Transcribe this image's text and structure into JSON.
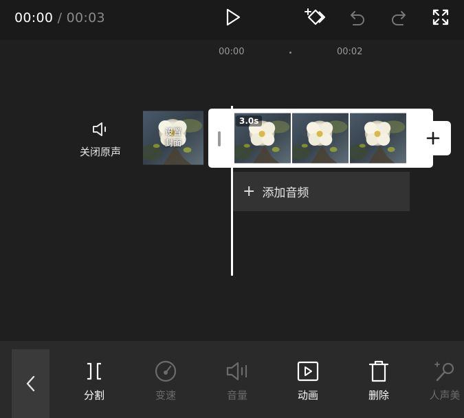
{
  "top_bar": {
    "current_time": "00:00",
    "separator": " / ",
    "total_time": "00:03",
    "icons": [
      "play-icon",
      "keyframe-icon",
      "undo-icon",
      "redo-icon",
      "fullscreen-icon"
    ]
  },
  "timeline": {
    "ruler": [
      "00:00",
      "00:02"
    ],
    "mute_label": "关闭原声",
    "cover_label_line1": "设置",
    "cover_label_line2": "封面",
    "clip_duration": "3.0s",
    "add_audio_plus": "+",
    "add_audio_label": "添加音频"
  },
  "toolbar": {
    "tools": [
      {
        "label": "分割",
        "enabled": true
      },
      {
        "label": "变速",
        "enabled": false
      },
      {
        "label": "音量",
        "enabled": false
      },
      {
        "label": "动画",
        "enabled": true
      },
      {
        "label": "删除",
        "enabled": true
      },
      {
        "label": "人声美",
        "enabled": false
      }
    ]
  },
  "colors": {
    "background": "#1f1f1f",
    "top_bar": "#1a1a1a",
    "toolbar": "#2a2a2a",
    "clip_frame": "#ffffff",
    "disabled_text": "#6b6b6b"
  }
}
